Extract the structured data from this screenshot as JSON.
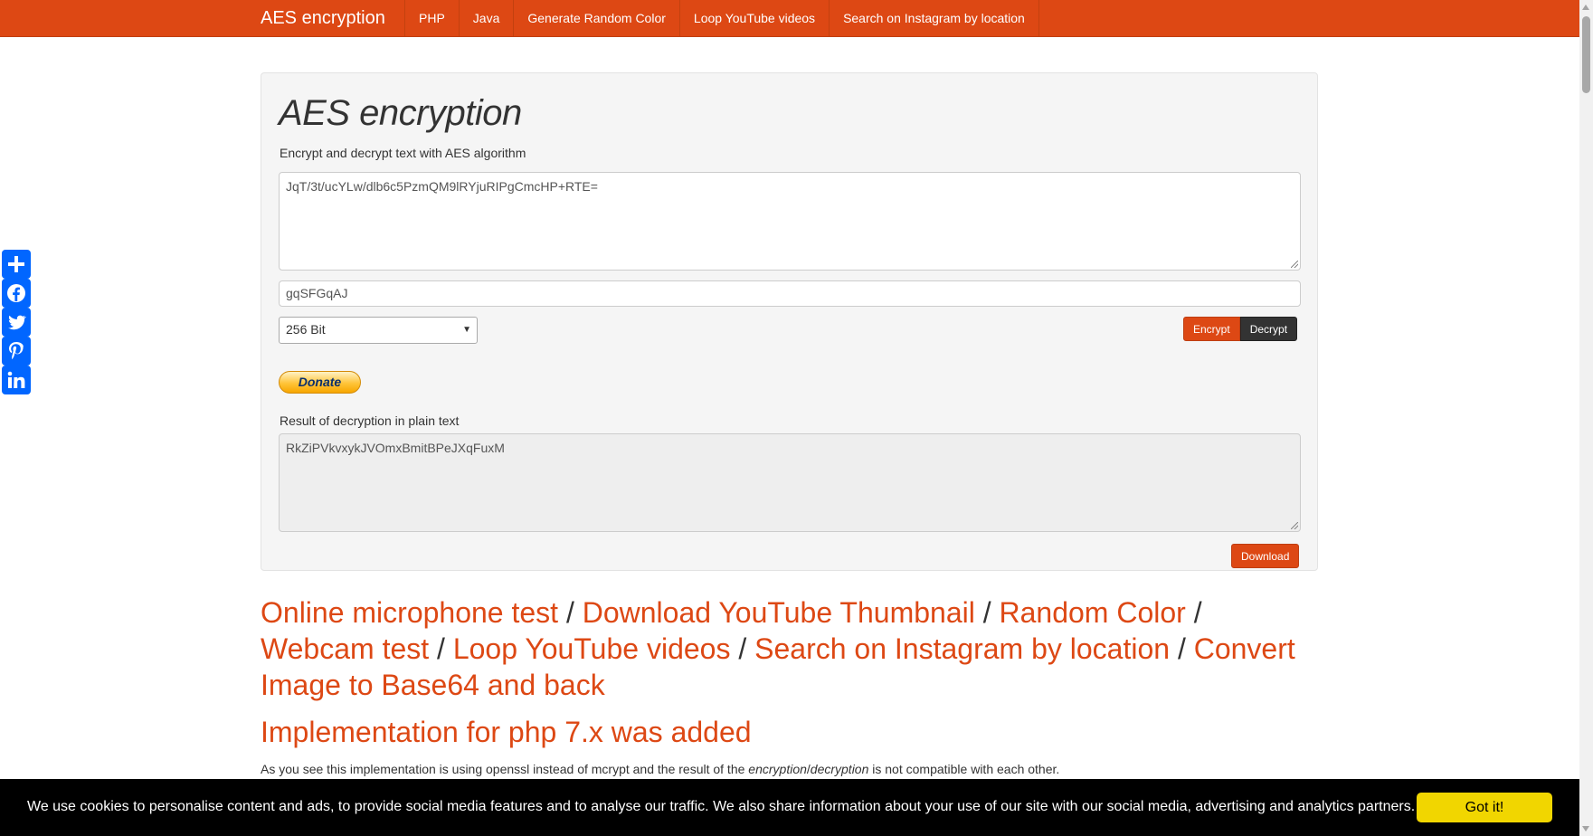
{
  "navbar": {
    "brand": "AES encryption",
    "items": [
      "PHP",
      "Java",
      "Generate Random Color",
      "Loop YouTube videos",
      "Search on Instagram by location"
    ]
  },
  "panel": {
    "title": "AES encryption",
    "subtitle": "Encrypt and decrypt text with AES algorithm",
    "input_text": "JqT/3t/ucYLw/dlb6c5PzmQM9lRYjuRIPgCmcHP+RTE=",
    "secret_key": "gqSFGqAJ",
    "key_size": "256 Bit",
    "encrypt_label": "Encrypt",
    "decrypt_label": "Decrypt",
    "donate_label": "Donate",
    "result_label": "Result of decryption in plain text",
    "result_text": "RkZiPVkvxykJVOmxBmitBPeJXqFuxM",
    "download_label": "Download"
  },
  "links": {
    "items": [
      "Online microphone test",
      "Download YouTube Thumbnail",
      "Random Color",
      "Webcam test",
      "Loop YouTube videos",
      "Search on Instagram by location",
      "Convert Image to Base64 and back"
    ],
    "separator": " / "
  },
  "implementation": {
    "heading": "Implementation for php 7.x was added",
    "para_before": "As you see this implementation is using openssl instead of mcrypt and the result of the ",
    "para_em1": "encryption",
    "para_slash": "/",
    "para_em2": "decryption",
    "para_after": " is not compatible with each other."
  },
  "cookie": {
    "text": "We use cookies to personalise content and ads, to provide social media features and to analyse our traffic. We also share information about your use of our site with our social media, advertising and analytics partners.",
    "button": "Got it!"
  },
  "social": [
    "share-icon",
    "facebook-icon",
    "twitter-icon",
    "pinterest-icon",
    "linkedin-icon"
  ],
  "colors": {
    "accent": "#dd4814",
    "dark": "#333333",
    "cookie_button": "#f1d600",
    "social": "#0166ff"
  }
}
